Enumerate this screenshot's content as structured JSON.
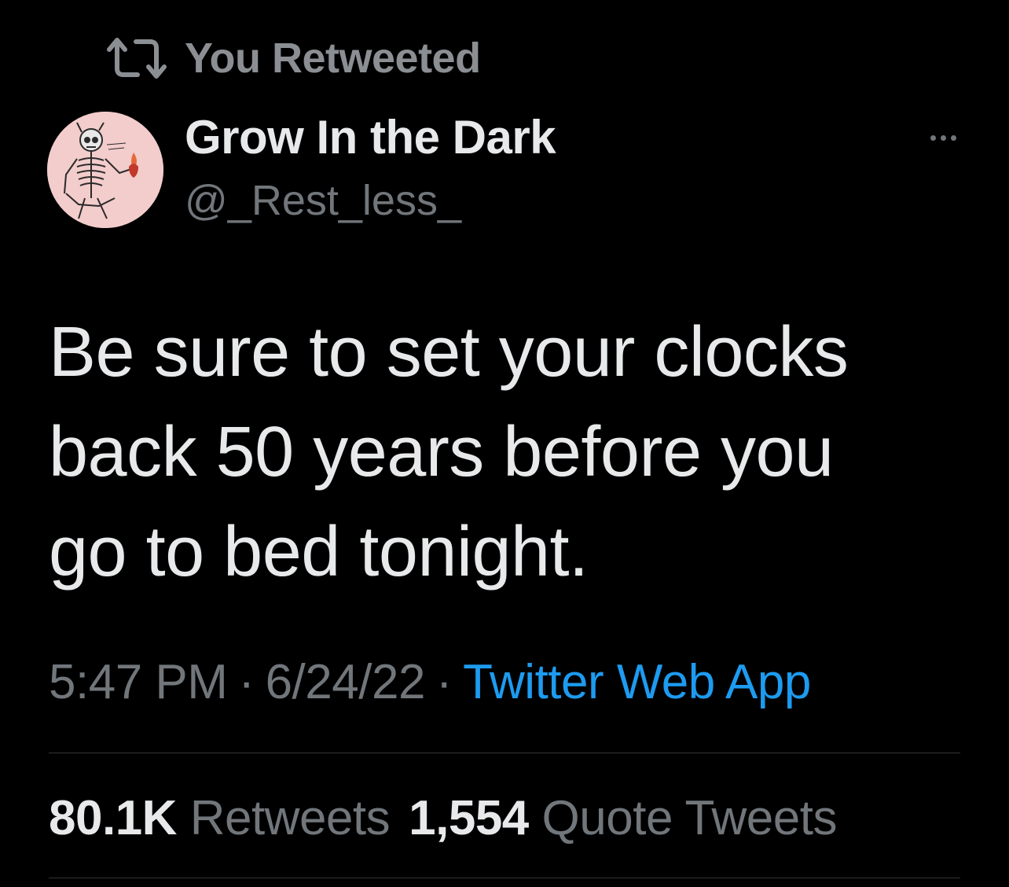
{
  "retweet_banner": {
    "label": "You Retweeted",
    "icon": "retweet-icon"
  },
  "author": {
    "display_name": "Grow In the Dark",
    "handle": "@_Rest_less_",
    "avatar": "skeleton-avatar"
  },
  "more_icon": "more-dots-icon",
  "tweet": {
    "lines": [
      "Be sure to set your clocks",
      "back 50 years before you",
      "go to bed tonight."
    ]
  },
  "meta": {
    "time": "5:47 PM",
    "date": "6/24/22",
    "separator": "·",
    "source": "Twitter Web App"
  },
  "stats": {
    "retweets_count": "80.1K",
    "retweets_label": "Retweets",
    "quotes_count": "1,554",
    "quotes_label": "Quote Tweets"
  },
  "colors": {
    "background": "#000000",
    "primary_text": "#e7e9ea",
    "secondary_text": "#71767b",
    "link": "#1d9bf0",
    "divider": "#2f3336"
  }
}
